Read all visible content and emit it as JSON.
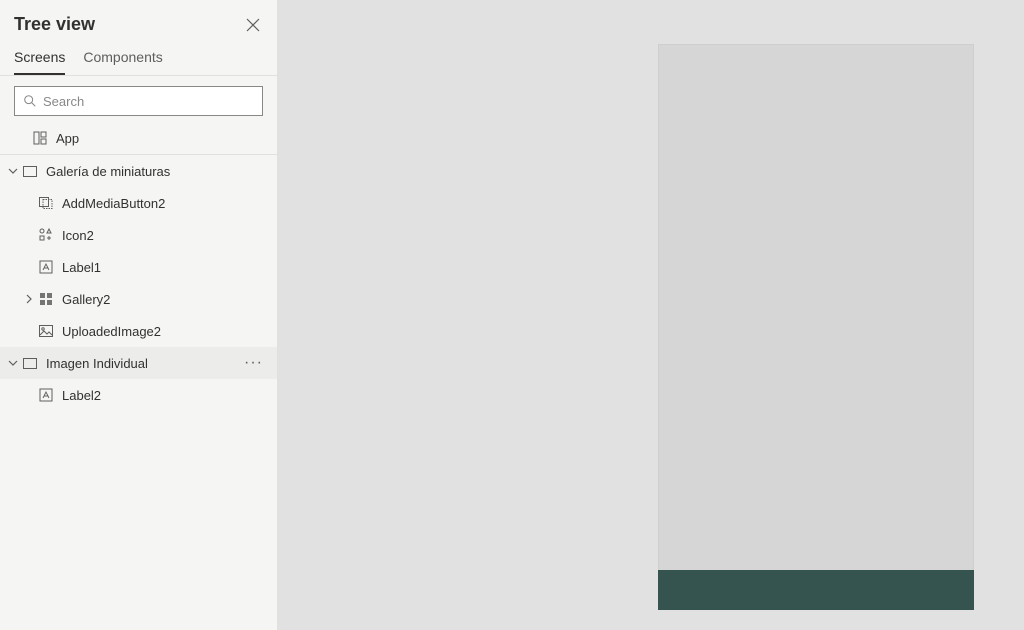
{
  "panel": {
    "title": "Tree view"
  },
  "tabs": {
    "screens": "Screens",
    "components": "Components"
  },
  "search": {
    "placeholder": "Search",
    "value": ""
  },
  "tree": {
    "app": "App",
    "screen1": "Galería de miniaturas",
    "screen1_children": {
      "addMedia": "AddMediaButton2",
      "icon2": "Icon2",
      "label1": "Label1",
      "gallery2": "Gallery2",
      "uploadedImage2": "UploadedImage2"
    },
    "screen2": "Imagen Individual",
    "screen2_children": {
      "label2": "Label2"
    }
  },
  "colors": {
    "previewBar": "#35534f"
  }
}
